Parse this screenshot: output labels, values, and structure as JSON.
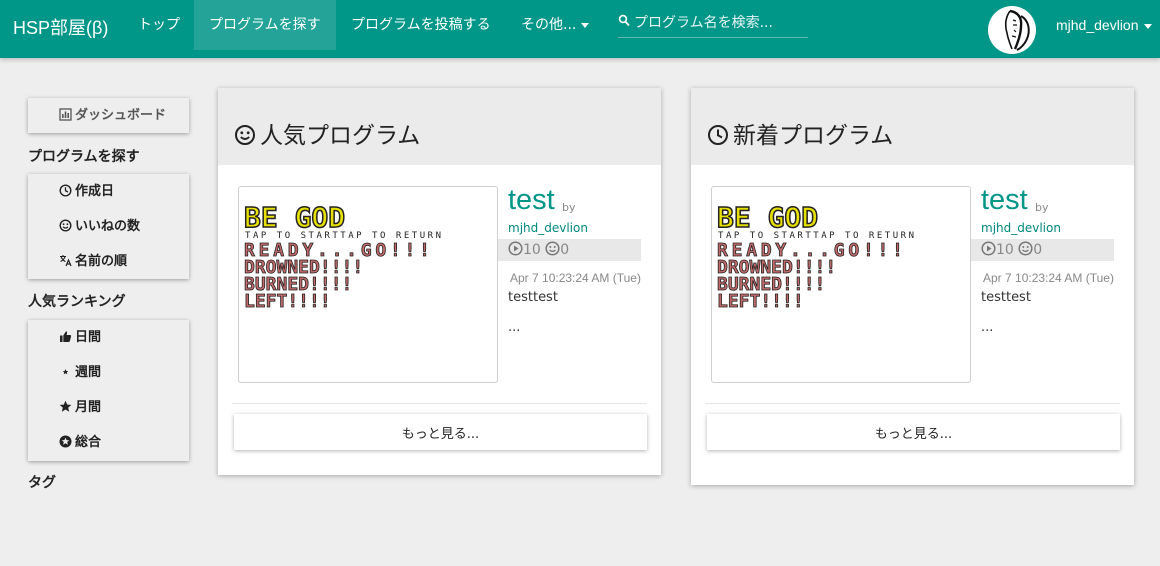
{
  "header": {
    "brand": "HSP部屋(β)",
    "nav": [
      {
        "label": "トップ"
      },
      {
        "label": "プログラムを探す"
      },
      {
        "label": "プログラムを投稿する"
      },
      {
        "label": "その他..."
      }
    ],
    "search_placeholder": "プログラム名を検索...",
    "username": "mjhd_devlion"
  },
  "sidebar": {
    "dashboard": "ダッシュボード",
    "find_heading": "プログラムを探す",
    "find_items": [
      {
        "label": "作成日",
        "icon": "clock-icon"
      },
      {
        "label": "いいねの数",
        "icon": "smiley-icon"
      },
      {
        "label": "名前の順",
        "icon": "translate-icon"
      }
    ],
    "ranking_heading": "人気ランキング",
    "ranking_items": [
      {
        "label": "日間",
        "icon": "thumbs-up-icon"
      },
      {
        "label": "週間",
        "icon": "small-star-icon"
      },
      {
        "label": "月間",
        "icon": "star-icon"
      },
      {
        "label": "総合",
        "icon": "star-circle-icon"
      }
    ],
    "tags_heading": "タグ"
  },
  "panels": [
    {
      "title": "人気プログラム",
      "program": {
        "title": "test",
        "by": "by",
        "author": "mjhd_devlion",
        "plays": "10",
        "likes": "0",
        "date": "Apr 7 10:23:24 AM (Tue)",
        "description": "testtest",
        "ellipsis": "..."
      },
      "more_label": "もっと見る..."
    },
    {
      "title": "新着プログラム",
      "program": {
        "title": "test",
        "by": "by",
        "author": "mjhd_devlion",
        "plays": "10",
        "likes": "0",
        "date": "Apr 7 10:23:24 AM (Tue)",
        "description": "testtest",
        "ellipsis": "..."
      },
      "more_label": "もっと見る..."
    }
  ],
  "thumbnail_text": {
    "title": "BE GOD",
    "sub": "TAP TO STARTTAP TO RETURN",
    "lines": [
      "READY...GO!!!",
      "DROWNED!!!!",
      "BURNED!!!!",
      "LEFT!!!!"
    ]
  },
  "colors": {
    "primary": "#009688",
    "link": "#00897b",
    "thumb_title": "#e8e000",
    "thumb_lines": "#c26a6a"
  }
}
